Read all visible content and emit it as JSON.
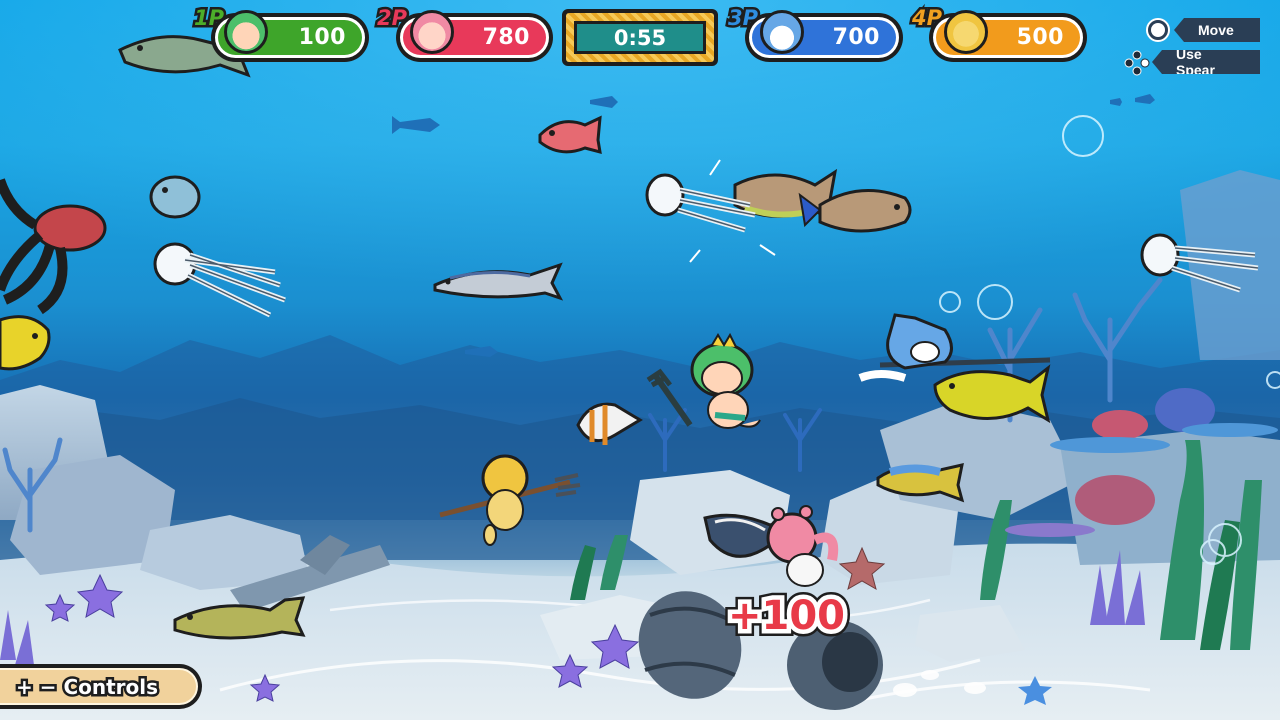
{
  "hud": {
    "players": [
      {
        "tag": "1P",
        "score": "100",
        "color": "#3ea52a",
        "tag_color": "#4caf2a",
        "avatar": "green-hair-boy-icon"
      },
      {
        "tag": "2P",
        "score": "780",
        "color": "#e8395a",
        "tag_color": "#e8395a",
        "avatar": "pink-hair-girl-icon"
      },
      {
        "tag": "3P",
        "score": "700",
        "color": "#2f73d9",
        "tag_color": "#2f8ee0",
        "avatar": "shark-hood-icon"
      },
      {
        "tag": "4P",
        "score": "500",
        "color": "#f29b1c",
        "tag_color": "#f0a020",
        "avatar": "yellow-cat-icon"
      }
    ],
    "timer": "0:55",
    "hints": [
      {
        "label": "Move",
        "icon": "left-stick-icon"
      },
      {
        "label": "Use Spear",
        "icon": "face-buttons-icon"
      }
    ],
    "controls_button": "+ − Controls",
    "score_popup": "+100"
  }
}
